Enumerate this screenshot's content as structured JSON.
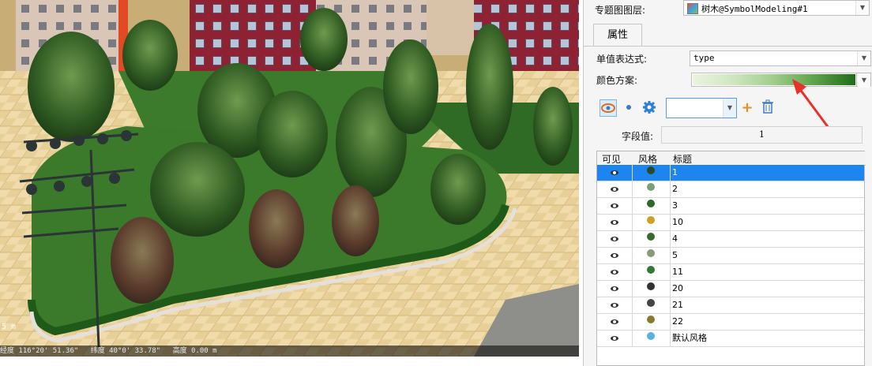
{
  "scene": {
    "scale_text": "5 m",
    "status": {
      "longitude": "经度 116°20' 51.36\"",
      "latitude": "纬度 40°0' 33.78\"",
      "altitude": "高度 0.00 m"
    }
  },
  "panel": {
    "layer_label": "专题图图层:",
    "layer_value": "树木@SymbolModeling#1",
    "tab_label": "属性",
    "expression_label": "单值表达式:",
    "expression_value": "type",
    "color_scheme_label": "颜色方案:",
    "field_value_label": "字段值:",
    "field_value": "1",
    "toolbar": {
      "icons": [
        "eye-icon",
        "dot-icon",
        "gear-icon",
        "add-icon",
        "delete-icon"
      ],
      "dropdown_value": ""
    },
    "table": {
      "headers": [
        "可见",
        "风格",
        "标题"
      ],
      "rows": [
        {
          "title": "1",
          "selected": true
        },
        {
          "title": "2"
        },
        {
          "title": "3"
        },
        {
          "title": "10"
        },
        {
          "title": "4"
        },
        {
          "title": "5"
        },
        {
          "title": "11"
        },
        {
          "title": "20"
        },
        {
          "title": "21"
        },
        {
          "title": "22"
        },
        {
          "title": "默认风格"
        }
      ]
    }
  },
  "colors": {
    "selection": "#1e84f0",
    "annotation_arrow": "#e8312a",
    "ramp_light": "#eaf4df",
    "ramp_dark": "#1f6b1a"
  }
}
